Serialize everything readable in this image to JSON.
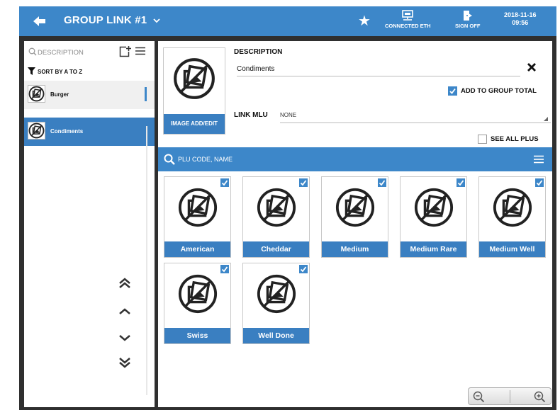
{
  "header": {
    "title": "GROUP LINK #1",
    "connected_label": "CONNECTED ETH",
    "signoff_label": "SIGN OFF",
    "date": "2018-11-16",
    "time": "09:56",
    "icons": [
      "back-arrow-icon",
      "chevron-down-icon",
      "star-icon",
      "network-icon",
      "sign-off-icon"
    ]
  },
  "sidebar": {
    "search_placeholder": "DESCRIPTION",
    "sort_label": "SORT BY A TO Z",
    "items": [
      {
        "label": "Burger",
        "selected": false
      },
      {
        "label": "Condiments",
        "selected": true
      }
    ]
  },
  "detail": {
    "image_button": "IMAGE ADD/EDIT",
    "description_label": "DESCRIPTION",
    "description_value": "Condiments",
    "add_to_group_total_label": "ADD TO GROUP TOTAL",
    "add_to_group_total_checked": true,
    "link_mlu_label": "LINK MLU",
    "link_mlu_value": "NONE",
    "see_all_plus_label": "SEE ALL PLUS",
    "see_all_plus_checked": false
  },
  "plu": {
    "search_placeholder": "PLU CODE, NAME",
    "items": [
      {
        "label": "American",
        "checked": true
      },
      {
        "label": "Cheddar",
        "checked": true
      },
      {
        "label": "Medium",
        "checked": true
      },
      {
        "label": "Medium Rare",
        "checked": true
      },
      {
        "label": "Medium Well",
        "checked": true
      },
      {
        "label": "Swiss",
        "checked": true
      },
      {
        "label": "Well Done",
        "checked": true
      }
    ]
  },
  "colors": {
    "accent": "#3d87c9",
    "selected": "#3a7fc1",
    "frame": "#2f2f2f"
  }
}
